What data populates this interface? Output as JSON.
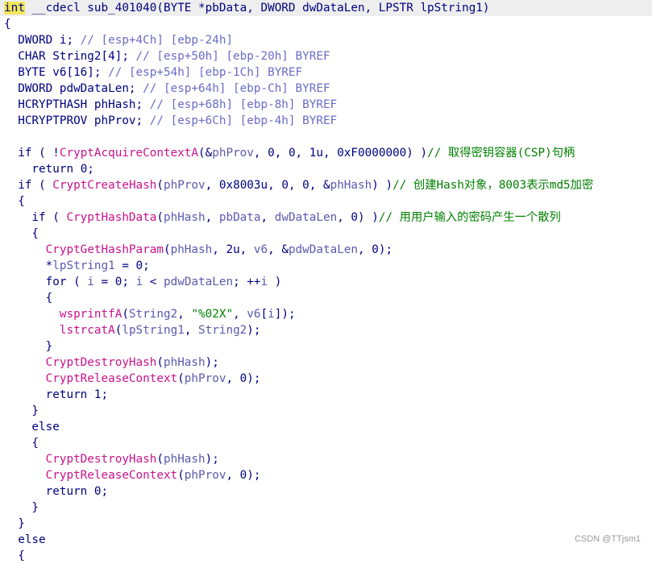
{
  "watermark": "CSDN @TTjsm1",
  "lines": [
    [
      [
        "kwhl",
        "int"
      ],
      [
        "id",
        " __cdecl sub_401040(BYTE *pbData, DWORD dwDataLen, LPSTR lpString1)"
      ]
    ],
    [
      [
        "pn",
        "{"
      ]
    ],
    [
      [
        "id",
        "  DWORD i; "
      ],
      [
        "cm",
        "// [esp+4Ch] [ebp-24h]"
      ]
    ],
    [
      [
        "id",
        "  CHAR String2[4]; "
      ],
      [
        "cm",
        "// [esp+50h] [ebp-20h] BYREF"
      ]
    ],
    [
      [
        "id",
        "  BYTE v6[16]; "
      ],
      [
        "cm",
        "// [esp+54h] [ebp-1Ch] BYREF"
      ]
    ],
    [
      [
        "id",
        "  DWORD pdwDataLen; "
      ],
      [
        "cm",
        "// [esp+64h] [ebp-Ch] BYREF"
      ]
    ],
    [
      [
        "id",
        "  HCRYPTHASH phHash; "
      ],
      [
        "cm",
        "// [esp+68h] [ebp-8h] BYREF"
      ]
    ],
    [
      [
        "id",
        "  HCRYPTPROV phProv; "
      ],
      [
        "cm",
        "// [esp+6Ch] [ebp-4h] BYREF"
      ]
    ],
    [
      [
        "id",
        ""
      ]
    ],
    [
      [
        "kw",
        "  if ( !"
      ],
      [
        "fn",
        "CryptAcquireContextA"
      ],
      [
        "pn",
        "(&"
      ],
      [
        "var",
        "phProv"
      ],
      [
        "pn",
        ", 0, 0, 1u, 0xF0000000) )"
      ],
      [
        "cmg",
        "// 取得密钥容器(CSP)句柄"
      ]
    ],
    [
      [
        "kw",
        "    return "
      ],
      [
        "num",
        "0"
      ],
      [
        "pn",
        ";"
      ]
    ],
    [
      [
        "kw",
        "  if ( "
      ],
      [
        "fn",
        "CryptCreateHash"
      ],
      [
        "pn",
        "("
      ],
      [
        "var",
        "phProv"
      ],
      [
        "pn",
        ", 0x8003u, 0, 0, &"
      ],
      [
        "var",
        "phHash"
      ],
      [
        "pn",
        ") )"
      ],
      [
        "cmg",
        "// 创建Hash对象，8003表示md5加密"
      ]
    ],
    [
      [
        "pn",
        "  {"
      ]
    ],
    [
      [
        "kw",
        "    if ( "
      ],
      [
        "fn",
        "CryptHashData"
      ],
      [
        "pn",
        "("
      ],
      [
        "var",
        "phHash"
      ],
      [
        "pn",
        ", "
      ],
      [
        "var",
        "pbData"
      ],
      [
        "pn",
        ", "
      ],
      [
        "var",
        "dwDataLen"
      ],
      [
        "pn",
        ", 0) )"
      ],
      [
        "cmg",
        "// 用用户输入的密码产生一个散列"
      ]
    ],
    [
      [
        "pn",
        "    {"
      ]
    ],
    [
      [
        "fn",
        "      CryptGetHashParam"
      ],
      [
        "pn",
        "("
      ],
      [
        "var",
        "phHash"
      ],
      [
        "pn",
        ", 2u, "
      ],
      [
        "var",
        "v6"
      ],
      [
        "pn",
        ", &"
      ],
      [
        "var",
        "pdwDataLen"
      ],
      [
        "pn",
        ", 0);"
      ]
    ],
    [
      [
        "pn",
        "      *"
      ],
      [
        "var",
        "lpString1"
      ],
      [
        "pn",
        " = 0;"
      ]
    ],
    [
      [
        "kw",
        "      for"
      ],
      [
        "pn",
        " ( "
      ],
      [
        "var",
        "i"
      ],
      [
        "pn",
        " = 0; "
      ],
      [
        "var",
        "i"
      ],
      [
        "pn",
        " < "
      ],
      [
        "var",
        "pdwDataLen"
      ],
      [
        "pn",
        "; ++"
      ],
      [
        "var",
        "i"
      ],
      [
        "pn",
        " )"
      ]
    ],
    [
      [
        "pn",
        "      {"
      ]
    ],
    [
      [
        "lib",
        "        wsprintfA"
      ],
      [
        "pn",
        "("
      ],
      [
        "var",
        "String2"
      ],
      [
        "pn",
        ", "
      ],
      [
        "str",
        "\"%02X\""
      ],
      [
        "pn",
        ", "
      ],
      [
        "var",
        "v6"
      ],
      [
        "pn",
        "["
      ],
      [
        "var",
        "i"
      ],
      [
        "pn",
        "]);"
      ]
    ],
    [
      [
        "lib",
        "        lstrcatA"
      ],
      [
        "pn",
        "("
      ],
      [
        "var",
        "lpString1"
      ],
      [
        "pn",
        ", "
      ],
      [
        "var",
        "String2"
      ],
      [
        "pn",
        ");"
      ]
    ],
    [
      [
        "pn",
        "      }"
      ]
    ],
    [
      [
        "fn",
        "      CryptDestroyHash"
      ],
      [
        "pn",
        "("
      ],
      [
        "var",
        "phHash"
      ],
      [
        "pn",
        ");"
      ]
    ],
    [
      [
        "fn",
        "      CryptReleaseContext"
      ],
      [
        "pn",
        "("
      ],
      [
        "var",
        "phProv"
      ],
      [
        "pn",
        ", 0);"
      ]
    ],
    [
      [
        "kw",
        "      return "
      ],
      [
        "num",
        "1"
      ],
      [
        "pn",
        ";"
      ]
    ],
    [
      [
        "pn",
        "    }"
      ]
    ],
    [
      [
        "kw",
        "    else"
      ]
    ],
    [
      [
        "pn",
        "    {"
      ]
    ],
    [
      [
        "fn",
        "      CryptDestroyHash"
      ],
      [
        "pn",
        "("
      ],
      [
        "var",
        "phHash"
      ],
      [
        "pn",
        ");"
      ]
    ],
    [
      [
        "fn",
        "      CryptReleaseContext"
      ],
      [
        "pn",
        "("
      ],
      [
        "var",
        "phProv"
      ],
      [
        "pn",
        ", 0);"
      ]
    ],
    [
      [
        "kw",
        "      return "
      ],
      [
        "num",
        "0"
      ],
      [
        "pn",
        ";"
      ]
    ],
    [
      [
        "pn",
        "    }"
      ]
    ],
    [
      [
        "pn",
        "  }"
      ]
    ],
    [
      [
        "kw",
        "  else"
      ]
    ],
    [
      [
        "pn",
        "  {"
      ]
    ]
  ]
}
